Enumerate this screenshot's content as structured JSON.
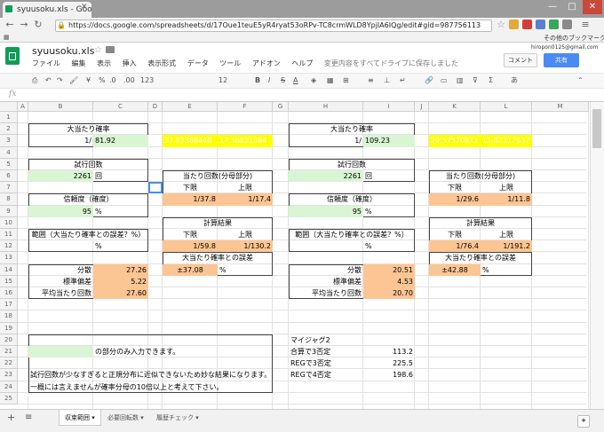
{
  "browser": {
    "tab_title": "syuusoku.xls - Goo",
    "url": "https://docs.google.com/spreadsheets/d/17Oue1teuE5yR4ryat53oRPv-TC8crmWLD8YpjlA6IQg/edit#gid=987756113",
    "bookmark_other": "その他のブックマーク"
  },
  "app": {
    "title": "syuusoku.xls",
    "menu": [
      "ファイル",
      "編集",
      "表示",
      "挿入",
      "表示形式",
      "データ",
      "ツール",
      "アドオン",
      "ヘルプ"
    ],
    "save_status": "変更内容をすべてドライブに保存しました",
    "account": "hiropon0125@gmail.com",
    "comment_button": "コメント",
    "share_button": "共有"
  },
  "toolbar": {
    "percent": "%",
    "decimal": ".0",
    "decimal2": ".00",
    "format123": "123",
    "font_size": "12",
    "bold": "B",
    "italic": "I",
    "strike": "S",
    "fontcolor": "A",
    "input_tool": "あ"
  },
  "formula_bar": {
    "label": "fx"
  },
  "columns": [
    "A",
    "B",
    "C",
    "D",
    "E",
    "F",
    "G",
    "H",
    "I",
    "J",
    "K",
    "L",
    "M"
  ],
  "rows": [
    "1",
    "2",
    "3",
    "4",
    "5",
    "6",
    "7",
    "8",
    "9",
    "10",
    "11",
    "12",
    "13",
    "14",
    "15",
    "16",
    "17",
    "18",
    "19",
    "20",
    "21",
    "22",
    "23",
    "24",
    "25"
  ],
  "cells": {
    "b2": "大当たり確率",
    "b3": "1/",
    "c3": "81.92",
    "b5": "試行回数",
    "b6": "2261",
    "c6": "回",
    "b8": "信頼度（確度）",
    "b9": "95",
    "c9": "%",
    "b11": "範囲（大当たり確率との誤差？%）",
    "c12": "%",
    "b14": "分散",
    "c14": "27.26",
    "b15": "標準偏差",
    "c15": "5.22",
    "b16": "平均当たり回数",
    "c16": "27.60",
    "e3": "37.83388448",
    "f3": "17.36831084",
    "e6": "当たり回数(分母部分)",
    "e7": "下限",
    "f7": "上限",
    "e8": "1/37.8",
    "f8": "1/17.4",
    "e10": "計算結果",
    "e11": "下限",
    "f11": "上限",
    "e12": "1/59.8",
    "f12": "1/130.2",
    "e13": "大当たり確率との誤差",
    "e14": "±37.08",
    "f14": "%",
    "h2": "大当たり確率",
    "h3": "1/",
    "i3": "109.23",
    "h5": "試行回数",
    "h6": "2261",
    "i6": "回",
    "h8": "信頼度（確度）",
    "h9": "95",
    "i9": "%",
    "h11": "範囲（大当たり確率との誤差？%）",
    "i12": "%",
    "h14": "分散",
    "i14": "20.51",
    "h15": "標準偏差",
    "i15": "4.53",
    "h16": "平均当たり回数",
    "i16": "20.70",
    "k3": "29.57570872",
    "l3": "11.82317637",
    "k6": "当たり回数(分母部分)",
    "k7": "下限",
    "l7": "上限",
    "k8": "1/29.6",
    "l8": "1/11.8",
    "k10": "計算結果",
    "k11": "下限",
    "l11": "上限",
    "k12": "1/76.4",
    "l12": "1/191.2",
    "k13": "大当たり確率との誤差",
    "k14": "±42.88",
    "l14": "%",
    "note1": "の部分のみ入力できます。",
    "note2": "試行回数が少なすぎると正規分布に近似できないため妙な結果になります。",
    "note3": "一概には言えませんが確率分母の10倍以上と考えて下さい。",
    "h20": "マイジャグ2",
    "h21": "合算で3否定",
    "i21": "113.2",
    "h22": "REGで3否定",
    "i22": "225.5",
    "h23": "REGで4否定",
    "i23": "198.6"
  },
  "sheet_tabs": [
    "収束範囲",
    "必要回転数",
    "履歴チェック"
  ],
  "colors": {
    "input_green": "#d9f5d3",
    "result_orange": "#fcc594",
    "highlight_yellow": "#ffff00",
    "sheets_green": "#0f9d58",
    "share_blue": "#4a8af4"
  }
}
